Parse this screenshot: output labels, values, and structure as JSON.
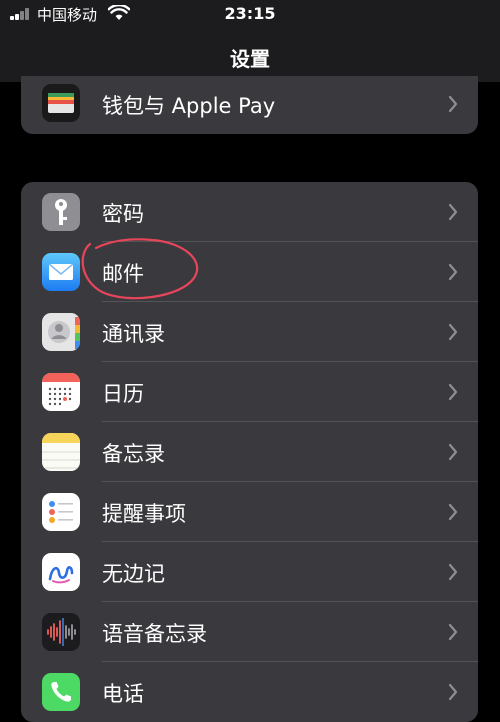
{
  "status_bar": {
    "carrier": "中国移动",
    "time": "23:15"
  },
  "nav": {
    "title": "设置"
  },
  "group1": {
    "items": [
      {
        "label": "钱包与 Apple Pay",
        "icon": "wallet-icon"
      }
    ]
  },
  "group2": {
    "items": [
      {
        "label": "密码",
        "icon": "key-icon"
      },
      {
        "label": "邮件",
        "icon": "mail-icon"
      },
      {
        "label": "通讯录",
        "icon": "contacts-icon"
      },
      {
        "label": "日历",
        "icon": "calendar-icon"
      },
      {
        "label": "备忘录",
        "icon": "notes-icon"
      },
      {
        "label": "提醒事项",
        "icon": "reminders-icon"
      },
      {
        "label": "无边记",
        "icon": "freeform-icon"
      },
      {
        "label": "语音备忘录",
        "icon": "voice-memos-icon"
      },
      {
        "label": "电话",
        "icon": "phone-icon"
      }
    ]
  },
  "colors": {
    "background": "#000000",
    "cell": "#3a3a3e",
    "separator": "#545458",
    "annotation": "#e8455a"
  }
}
